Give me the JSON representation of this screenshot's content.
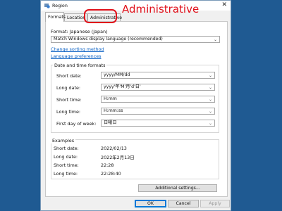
{
  "window": {
    "title": "Region",
    "close_glyph": "✕"
  },
  "tabs": [
    {
      "label": "Formats"
    },
    {
      "label": "Location"
    },
    {
      "label": "Administrative"
    }
  ],
  "annotation": {
    "text": "Administrative",
    "color": "#e0101a"
  },
  "formats": {
    "format_label": "Format: Japanese (Japan)",
    "format_value": "Match Windows display language (recommended)",
    "change_sorting_link": "Change sorting method",
    "language_prefs_link": "Language preferences"
  },
  "date_time": {
    "group_title": "Date and time formats",
    "rows": [
      {
        "label": "Short date:",
        "value": "yyyy/MM/dd"
      },
      {
        "label": "Long date:",
        "value": "yyyy'年'M'月'd'日'"
      },
      {
        "label": "Short time:",
        "value": "H:mm"
      },
      {
        "label": "Long time:",
        "value": "H:mm:ss"
      },
      {
        "label": "First day of week:",
        "value": "日曜日"
      }
    ]
  },
  "examples": {
    "group_title": "Examples",
    "rows": [
      {
        "label": "Short date:",
        "value": "2022/02/13"
      },
      {
        "label": "Long date:",
        "value": "2022年2月13日"
      },
      {
        "label": "Short time:",
        "value": "22:28"
      },
      {
        "label": "Long time:",
        "value": "22:28:40"
      }
    ]
  },
  "buttons": {
    "additional": "Additional settings...",
    "ok": "OK",
    "cancel": "Cancel",
    "apply": "Apply"
  },
  "icons": {
    "chevron": "⌄",
    "title_icon": "region-globe-icon"
  }
}
